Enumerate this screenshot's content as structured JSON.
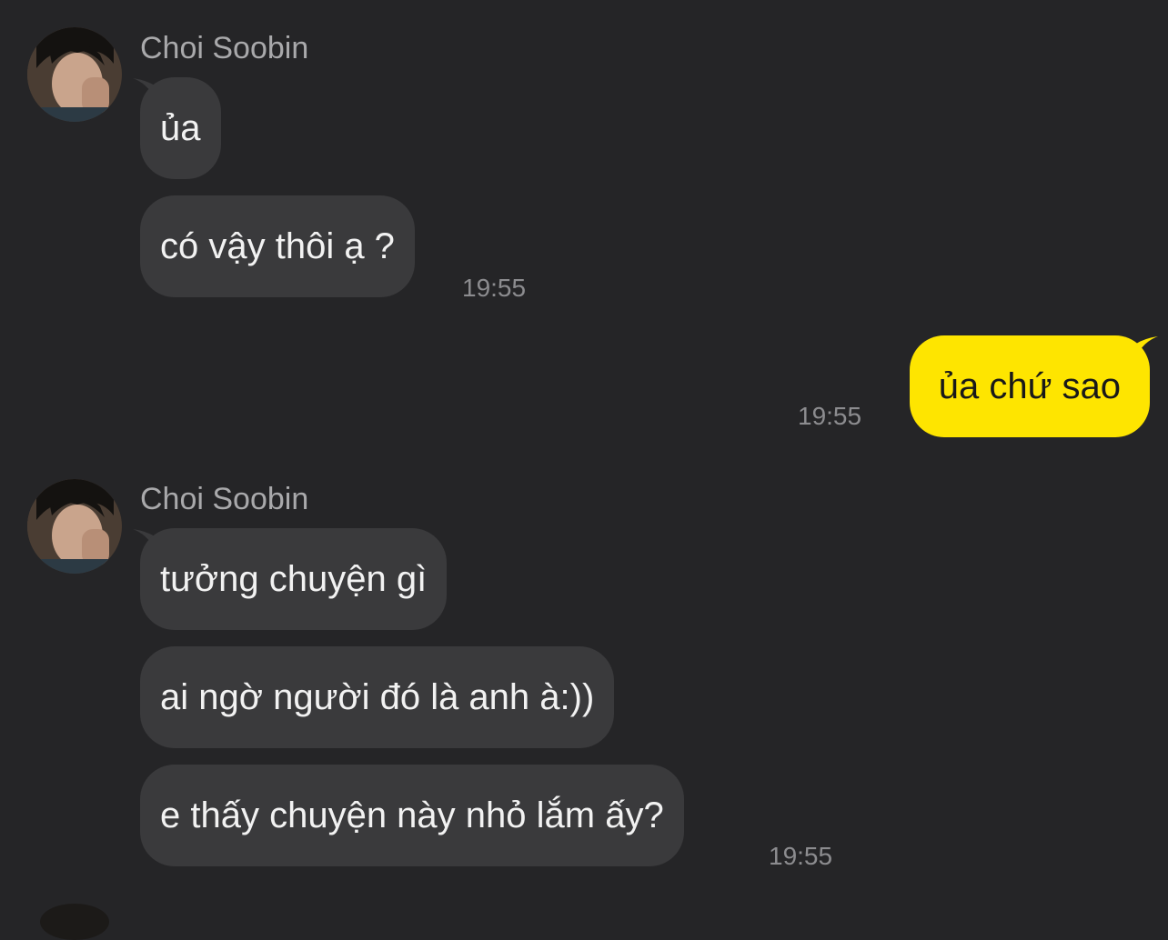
{
  "chat": {
    "groups": [
      {
        "sender": "Choi Soobin",
        "avatar_icon": "profile-photo",
        "messages": [
          "ủa",
          "có vậy thôi ạ ?"
        ],
        "time": "19:55"
      },
      {
        "sender": "me",
        "messages": [
          "ủa chứ sao"
        ],
        "time": "19:55"
      },
      {
        "sender": "Choi Soobin",
        "avatar_icon": "profile-photo",
        "messages": [
          "tưởng chuyện gì",
          "ai ngờ người đó là anh à:))",
          "e thấy chuyện này nhỏ lắm ấy?"
        ],
        "time": "19:55"
      }
    ]
  },
  "colors": {
    "background": "#252527",
    "incoming_bubble": "#3a3a3c",
    "outgoing_bubble": "#fee500",
    "timestamp": "#8c8c8f",
    "sender_name": "#a9a9ab"
  }
}
